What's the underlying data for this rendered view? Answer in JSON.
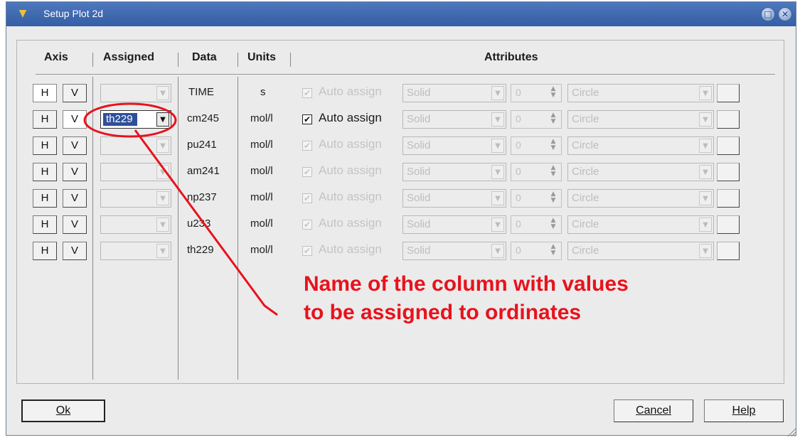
{
  "window": {
    "title": "Setup Plot 2d",
    "icons": {
      "app": "app-menu-icon",
      "maximize": "maximize-icon",
      "close": "close-icon"
    }
  },
  "headers": {
    "axis": "Axis",
    "assigned": "Assigned",
    "data": "Data",
    "units": "Units",
    "attributes": "Attributes"
  },
  "labels": {
    "h": "H",
    "v": "V"
  },
  "rows": [
    {
      "data": "TIME",
      "units": "s",
      "assigned": "",
      "auto_label": "Auto assign",
      "auto_checked": true,
      "enabled": false,
      "line": "Solid",
      "width": "0",
      "marker": "Circle"
    },
    {
      "data": "cm245",
      "units": "mol/l",
      "assigned": "th229",
      "auto_label": "Auto assign",
      "auto_checked": true,
      "enabled": true,
      "line": "Solid",
      "width": "0",
      "marker": "Circle"
    },
    {
      "data": "pu241",
      "units": "mol/l",
      "assigned": "",
      "auto_label": "Auto assign",
      "auto_checked": true,
      "enabled": false,
      "line": "Solid",
      "width": "0",
      "marker": "Circle"
    },
    {
      "data": "am241",
      "units": "mol/l",
      "assigned": "",
      "auto_label": "Auto assign",
      "auto_checked": true,
      "enabled": false,
      "line": "Solid",
      "width": "0",
      "marker": "Circle"
    },
    {
      "data": "np237",
      "units": "mol/l",
      "assigned": "",
      "auto_label": "Auto assign",
      "auto_checked": true,
      "enabled": false,
      "line": "Solid",
      "width": "0",
      "marker": "Circle"
    },
    {
      "data": "u233",
      "units": "mol/l",
      "assigned": "",
      "auto_label": "Auto assign",
      "auto_checked": true,
      "enabled": false,
      "line": "Solid",
      "width": "0",
      "marker": "Circle"
    },
    {
      "data": "th229",
      "units": "mol/l",
      "assigned": "",
      "auto_label": "Auto assign",
      "auto_checked": true,
      "enabled": false,
      "line": "Solid",
      "width": "0",
      "marker": "Circle"
    }
  ],
  "annotation": {
    "line1": "Name of the column with values",
    "line2": "to be assigned to ordinates",
    "color": "#e8121c"
  },
  "footer": {
    "ok": "Ok",
    "cancel": "Cancel",
    "help": "Help"
  },
  "colors": {
    "titlebar": "#3f68ad",
    "selection": "#2f4f9b",
    "annotation": "#e8121c"
  }
}
